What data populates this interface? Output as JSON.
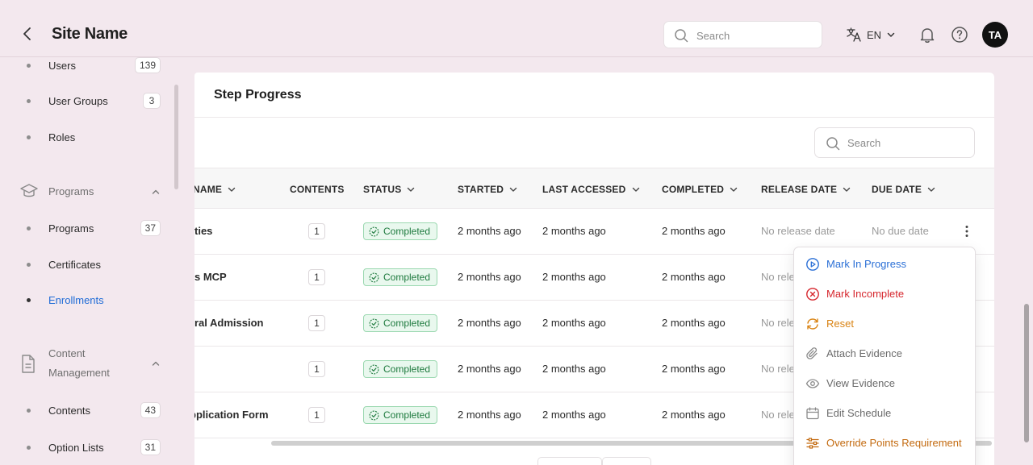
{
  "header": {
    "site_name": "Site Name",
    "search_placeholder": "Search",
    "language": "EN",
    "avatar_initials": "TA"
  },
  "sidebar": {
    "items_top": [
      {
        "label": "Users",
        "count": "139"
      },
      {
        "label": "User Groups",
        "count": "3"
      },
      {
        "label": "Roles",
        "count": ""
      }
    ],
    "programs_group": {
      "label": "Programs",
      "items": [
        {
          "label": "Programs",
          "count": "37"
        },
        {
          "label": "Certificates",
          "count": ""
        },
        {
          "label": "Enrollments",
          "count": "",
          "active": true
        }
      ]
    },
    "content_group": {
      "label_line1": "Content",
      "label_line2": "Management",
      "items": [
        {
          "label": "Contents",
          "count": "43"
        },
        {
          "label": "Option Lists",
          "count": "31"
        }
      ]
    }
  },
  "card": {
    "title": "Step Progress",
    "search_placeholder": "Search"
  },
  "table": {
    "columns": [
      "NAME",
      "CONTENTS",
      "STATUS",
      "STARTED",
      "LAST ACCESSED",
      "COMPLETED",
      "RELEASE DATE",
      "DUE DATE"
    ],
    "rows": [
      {
        "name": "ties",
        "contents": "1",
        "status": "Completed",
        "started": "2 months ago",
        "last_accessed": "2 months ago",
        "completed": "2 months ago",
        "release": "No release date",
        "due": "No due date"
      },
      {
        "name": "s MCP",
        "contents": "1",
        "status": "Completed",
        "started": "2 months ago",
        "last_accessed": "2 months ago",
        "completed": "2 months ago",
        "release": "No rele",
        "due": ""
      },
      {
        "name": "ral Admission",
        "contents": "1",
        "status": "Completed",
        "started": "2 months ago",
        "last_accessed": "2 months ago",
        "completed": "2 months ago",
        "release": "No rele",
        "due": ""
      },
      {
        "name": "",
        "contents": "1",
        "status": "Completed",
        "started": "2 months ago",
        "last_accessed": "2 months ago",
        "completed": "2 months ago",
        "release": "No rele",
        "due": ""
      },
      {
        "name": "pplication Form",
        "contents": "1",
        "status": "Completed",
        "started": "2 months ago",
        "last_accessed": "2 months ago",
        "completed": "2 months ago",
        "release": "No rele",
        "due": ""
      }
    ]
  },
  "menu": {
    "items": [
      {
        "label": "Mark In Progress",
        "icon": "play-circle-icon",
        "color": "#2a6fd6"
      },
      {
        "label": "Mark Incomplete",
        "icon": "x-circle-icon",
        "color": "#d6262d"
      },
      {
        "label": "Reset",
        "icon": "refresh-icon",
        "color": "#d98313"
      },
      {
        "label": "Attach Evidence",
        "icon": "paperclip-icon",
        "color": "#6b6b6b"
      },
      {
        "label": "View Evidence",
        "icon": "eye-icon",
        "color": "#6b6b6b"
      },
      {
        "label": "Edit Schedule",
        "icon": "calendar-icon",
        "color": "#6b6b6b"
      },
      {
        "label": "Override Points Requirement",
        "icon": "sliders-icon",
        "color": "#c36a0f"
      }
    ]
  },
  "colors": {
    "background": "#f3e8ee",
    "accent": "#1e6bd6",
    "success": "#1e7a3e",
    "danger": "#d6262d",
    "warning": "#d98313"
  }
}
